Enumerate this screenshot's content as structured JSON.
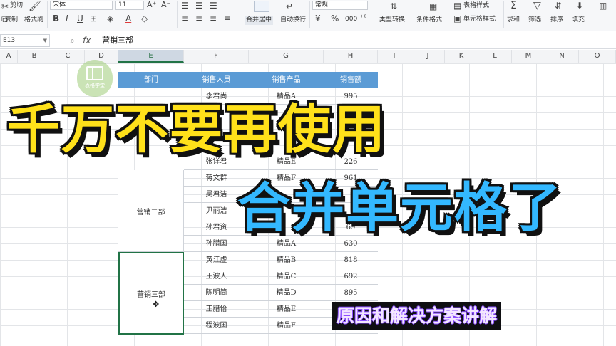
{
  "ribbon": {
    "clipboard": {
      "cut": "剪切",
      "copy": "复制",
      "format_painter": "格式刷"
    },
    "font": {
      "family": "宋体",
      "size": "11",
      "bold": "B",
      "italic": "I",
      "underline": "U",
      "font_color": "A",
      "font_color_swatch": "#e03b3b"
    },
    "alignment": {
      "merge_center": "合并居中",
      "wrap_text": "自动换行"
    },
    "number": {
      "format": "常规",
      "currency": "¥",
      "percent": "%",
      "thousands": "000"
    },
    "styles": {
      "type_convert": "类型转换",
      "conditional_format": "条件格式",
      "table_style": "表格样式",
      "cell_style": "单元格样式"
    },
    "editing": {
      "sum": "求和",
      "filter": "筛选",
      "sort": "排序",
      "fill": "填充"
    }
  },
  "formula_bar": {
    "name_box": "E13",
    "fx": "fx",
    "content": "营销三部"
  },
  "columns": [
    "A",
    "B",
    "C",
    "D",
    "E",
    "F",
    "G",
    "H",
    "I",
    "J",
    "K",
    "L",
    "M",
    "N",
    "O"
  ],
  "table": {
    "headers": [
      "部门",
      "销售人员",
      "销售产品",
      "销售额"
    ],
    "rows": [
      {
        "name": "李君尚",
        "product": "精品A",
        "amount": "995"
      },
      {
        "name": "张详君",
        "product": "精品E",
        "amount": "226"
      },
      {
        "name": "蒋文群",
        "product": "精品F",
        "amount": "961"
      },
      {
        "name": "吴君洁",
        "product": "",
        "amount": ""
      },
      {
        "name": "尹丽洁",
        "product": "",
        "amount": ""
      },
      {
        "name": "孙君资",
        "product": "",
        "amount": "69"
      },
      {
        "name": "孙腊国",
        "product": "精品A",
        "amount": "630"
      },
      {
        "name": "黄江虚",
        "product": "精品B",
        "amount": "818"
      },
      {
        "name": "王波人",
        "product": "精品C",
        "amount": "692"
      },
      {
        "name": "陈明简",
        "product": "精品D",
        "amount": "895"
      },
      {
        "name": "王腊怡",
        "product": "精品E",
        "amount": ""
      },
      {
        "name": "程波国",
        "product": "精品F",
        "amount": ""
      }
    ],
    "dept2": "营销二部",
    "dept3": "营销三部"
  },
  "logo": {
    "text": "表格学堂"
  },
  "overlay": {
    "title_line1": "千万不要再使用",
    "title_line2": "合并单元格了",
    "subtitle": "原因和解决方案讲解",
    "title1_color": "#ffe11a",
    "title2_color": "#33b8ff"
  }
}
